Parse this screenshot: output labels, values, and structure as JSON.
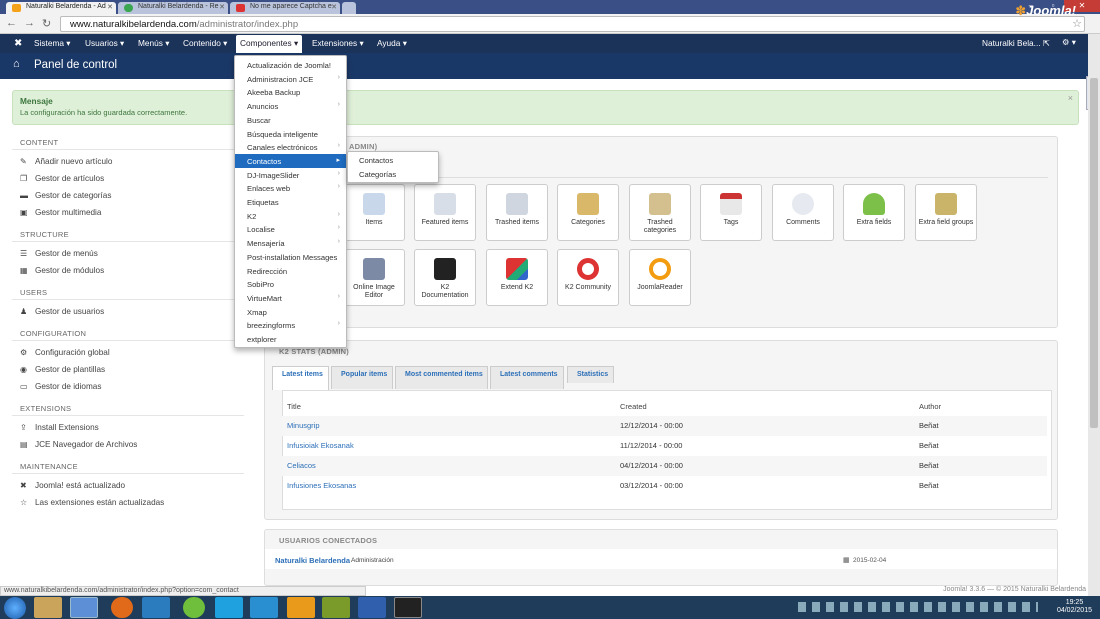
{
  "browser": {
    "tabs": [
      {
        "title": "Naturalki Belardenda - Ad",
        "active": true
      },
      {
        "title": "Naturalki Belardenda - Re",
        "active": false
      },
      {
        "title": "No me aparece Captcha e",
        "active": false
      }
    ],
    "url_host": "www.naturalkibelardenda.com",
    "url_path": "/administrator/index.php",
    "status_url": "www.naturalkibelardenda.com/administrator/index.php?option=com_contact"
  },
  "topnav": {
    "items": [
      "Sistema",
      "Usuarios",
      "Menús",
      "Contenido",
      "Componentes",
      "Extensiones",
      "Ayuda"
    ],
    "active": "Componentes",
    "user": "Naturalki Bela..."
  },
  "header": {
    "title": "Panel de control",
    "brand": "Joomla!"
  },
  "message": {
    "heading": "Mensaje",
    "body": "La configuración ha sido guardada correctamente."
  },
  "sidebar": {
    "sections": [
      {
        "title": "CONTENT",
        "items": [
          {
            "icon": "pencil-icon",
            "label": "Añadir nuevo artículo"
          },
          {
            "icon": "stack-icon",
            "label": "Gestor de artículos"
          },
          {
            "icon": "folder-icon",
            "label": "Gestor de categorías"
          },
          {
            "icon": "image-icon",
            "label": "Gestor multimedia"
          }
        ]
      },
      {
        "title": "STRUCTURE",
        "items": [
          {
            "icon": "list-icon",
            "label": "Gestor de menús"
          },
          {
            "icon": "cube-icon",
            "label": "Gestor de módulos"
          }
        ]
      },
      {
        "title": "USERS",
        "items": [
          {
            "icon": "users-icon",
            "label": "Gestor de usuarios"
          }
        ]
      },
      {
        "title": "CONFIGURATION",
        "items": [
          {
            "icon": "cog-icon",
            "label": "Configuración global"
          },
          {
            "icon": "eye-icon",
            "label": "Gestor de plantillas"
          },
          {
            "icon": "comment-icon",
            "label": "Gestor de idiomas"
          }
        ]
      },
      {
        "title": "EXTENSIONS",
        "items": [
          {
            "icon": "upload-icon",
            "label": "Install Extensions"
          },
          {
            "icon": "archive-icon",
            "label": "JCE Navegador de Archivos"
          }
        ]
      },
      {
        "title": "MAINTENANCE",
        "items": [
          {
            "icon": "joomla-icon",
            "label": "Joomla! está actualizado"
          },
          {
            "icon": "star-icon",
            "label": "Las extensiones están actualizadas"
          }
        ]
      }
    ]
  },
  "quickicons": {
    "heading": "ADMIN)",
    "tiles": [
      "Items",
      "Featured items",
      "Trashed items",
      "Categories",
      "Trashed categories",
      "Tags",
      "Comments",
      "Extra fields",
      "Extra field groups",
      "Online Image Editor",
      "K2 Documentation",
      "Extend K2",
      "K2 Community",
      "JoomlaReader"
    ]
  },
  "k2stats": {
    "heading": "K2 STATS (ADMIN)",
    "tabs": [
      "Latest items",
      "Popular items",
      "Most commented items",
      "Latest comments",
      "Statistics"
    ],
    "columns": [
      "Title",
      "Created",
      "Author"
    ],
    "rows": [
      {
        "title": "Minusgrip",
        "created": "12/12/2014 - 00:00",
        "author": "Beñat"
      },
      {
        "title": "Infusioiak Ekosanak",
        "created": "11/12/2014 - 00:00",
        "author": "Beñat"
      },
      {
        "title": "Celiacos",
        "created": "04/12/2014 - 00:00",
        "author": "Beñat"
      },
      {
        "title": "Infusiones Ekosanas",
        "created": "03/12/2014 - 00:00",
        "author": "Beñat"
      }
    ]
  },
  "online": {
    "heading": "USUARIOS CONECTADOS",
    "user": "Naturalki Belardenda",
    "role": "Administración",
    "date": "2015-02-04"
  },
  "dropdown": {
    "items": [
      {
        "label": "Actualización de Joomla!",
        "sub": false
      },
      {
        "label": "Administracion JCE",
        "sub": true
      },
      {
        "label": "Akeeba Backup",
        "sub": false
      },
      {
        "label": "Anuncios",
        "sub": true
      },
      {
        "label": "Buscar",
        "sub": false
      },
      {
        "label": "Búsqueda inteligente",
        "sub": false
      },
      {
        "label": "Canales electrónicos",
        "sub": true
      },
      {
        "label": "Contactos",
        "sub": true,
        "selected": true
      },
      {
        "label": "DJ-ImageSlider",
        "sub": true
      },
      {
        "label": "Enlaces web",
        "sub": true
      },
      {
        "label": "Etiquetas",
        "sub": false
      },
      {
        "label": "K2",
        "sub": true
      },
      {
        "label": "Localise",
        "sub": true
      },
      {
        "label": "Mensajería",
        "sub": true
      },
      {
        "label": "Post-installation Messages",
        "sub": false
      },
      {
        "label": "Redirección",
        "sub": false
      },
      {
        "label": "SobiPro",
        "sub": false
      },
      {
        "label": "VirtueMart",
        "sub": true
      },
      {
        "label": "Xmap",
        "sub": false
      },
      {
        "label": "breezingforms",
        "sub": true
      },
      {
        "label": "extplorer",
        "sub": false
      }
    ],
    "submenu": [
      "Contactos",
      "Categorías"
    ]
  },
  "footer": "Joomla! 3.3.6 — © 2015 Naturalki Belardenda",
  "clock": {
    "time": "19:25",
    "date": "04/02/2015"
  }
}
